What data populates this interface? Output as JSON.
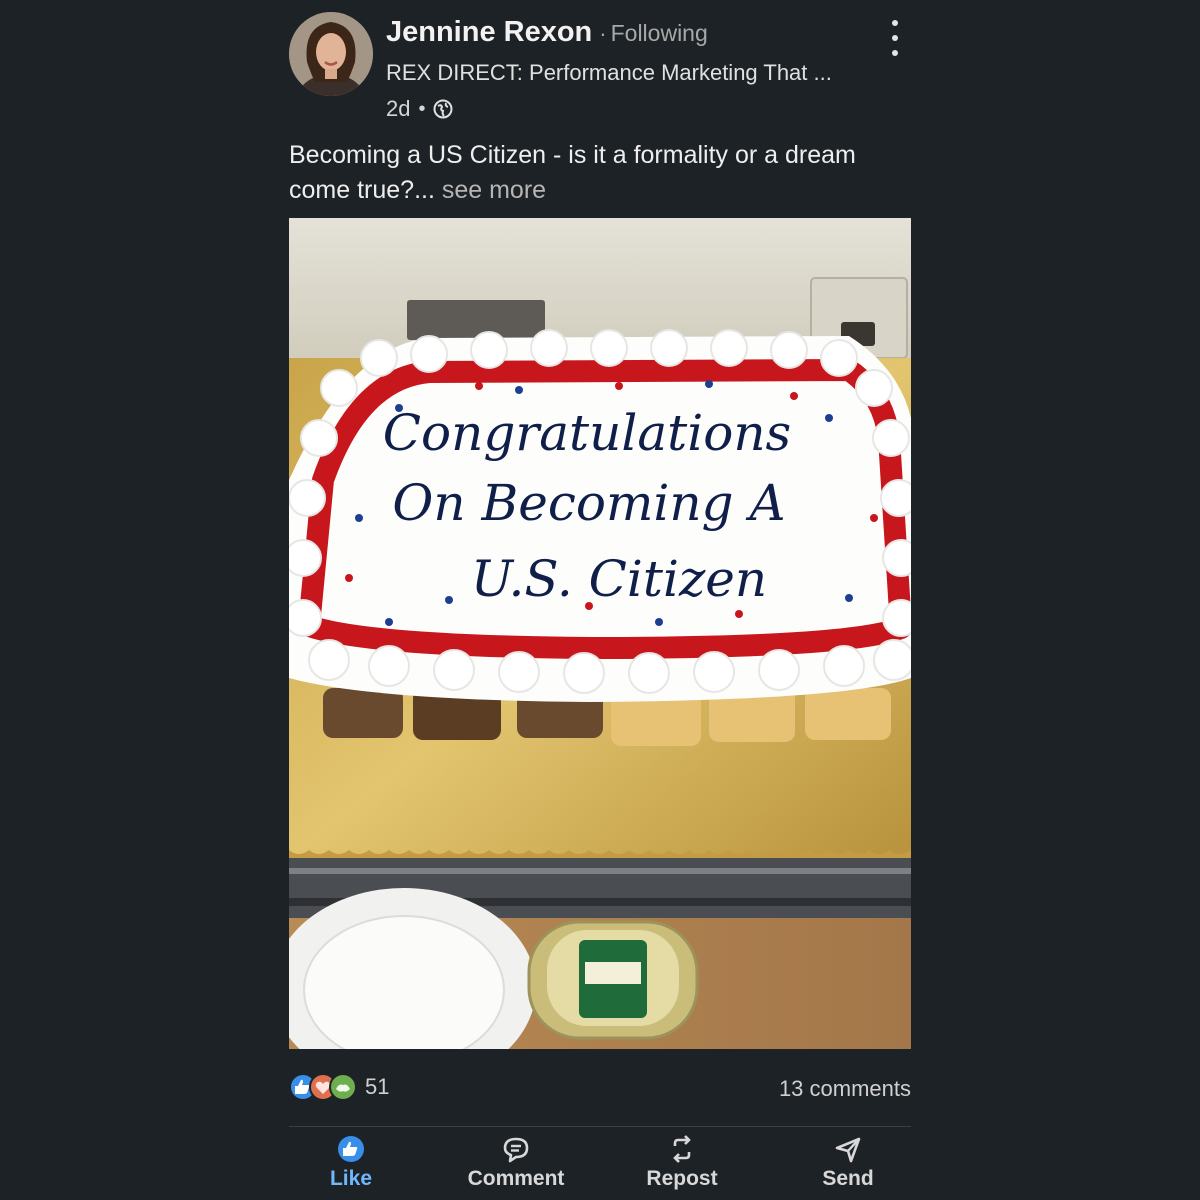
{
  "post": {
    "author": {
      "name": "Jennine Rexon",
      "separator": "·",
      "connection": "Following",
      "headline": "REX DIRECT: Performance Marketing That ...",
      "time": "2d",
      "time_separator": "•",
      "visibility_icon": "globe-icon"
    },
    "text": "Becoming a US Citizen - is it a formality or a dream come true?",
    "ellipsis": "...",
    "see_more": " see more",
    "image": {
      "cake_line1": "Congratulations",
      "cake_line2": "On Becoming A",
      "cake_line3": "U.S. Citizen"
    },
    "social": {
      "reaction_icons": [
        "like-reaction-icon",
        "love-reaction-icon",
        "support-reaction-icon"
      ],
      "reaction_count": "51",
      "comments": "13 comments"
    },
    "actions": [
      {
        "label": "Like",
        "icon": "thumbs-up-icon"
      },
      {
        "label": "Comment",
        "icon": "comment-icon"
      },
      {
        "label": "Repost",
        "icon": "repost-icon"
      },
      {
        "label": "Send",
        "icon": "send-icon"
      }
    ]
  },
  "colors": {
    "background": "#1d2226",
    "like_accent": "#71b7fb",
    "cake_red": "#c8161d",
    "icing_text": "#0f1f4a"
  }
}
